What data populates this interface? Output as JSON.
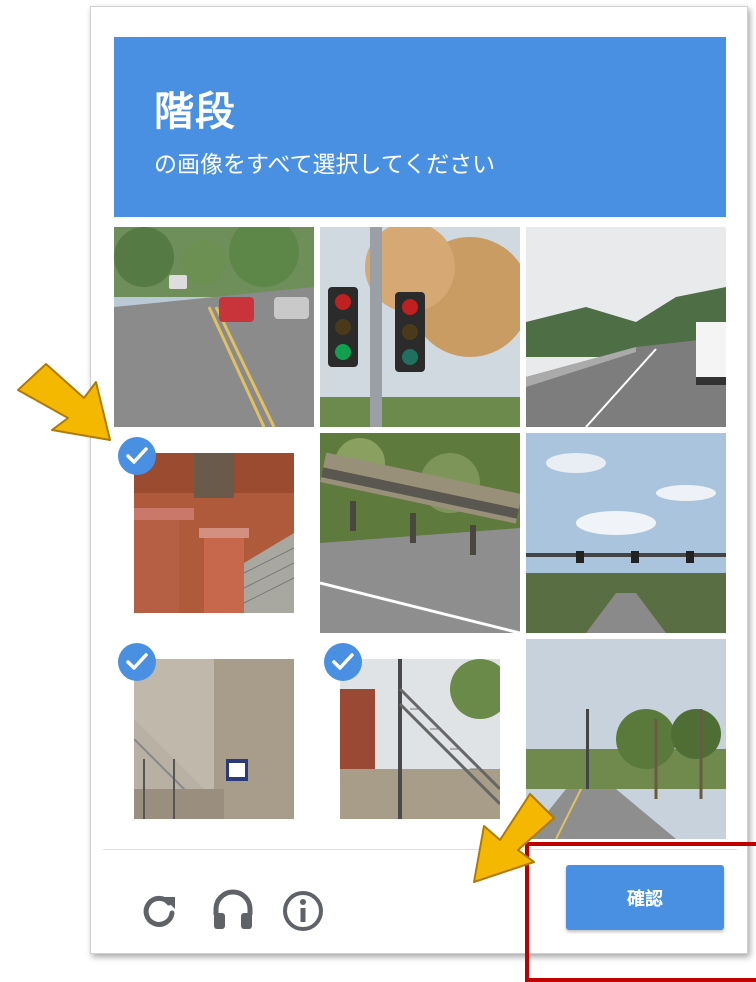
{
  "header": {
    "title": "階段",
    "subtitle": "の画像をすべて選択してください",
    "background": "#4a90e2"
  },
  "grid": {
    "tiles": [
      {
        "scene": "road with cars",
        "selected": false
      },
      {
        "scene": "traffic lights",
        "selected": false
      },
      {
        "scene": "highway with truck",
        "selected": false
      },
      {
        "scene": "brick stairs",
        "selected": true
      },
      {
        "scene": "roadside guardrail",
        "selected": false
      },
      {
        "scene": "road with signals",
        "selected": false
      },
      {
        "scene": "concrete stairs",
        "selected": true
      },
      {
        "scene": "outdoor metal stairs",
        "selected": true
      },
      {
        "scene": "road with palm trees",
        "selected": false
      }
    ]
  },
  "footer": {
    "icons": [
      "reload-icon",
      "audio-icon",
      "info-icon"
    ],
    "verify_label": "確認"
  },
  "annotations": {
    "arrow_color": "#f5b800",
    "highlight_color": "#c00000"
  }
}
